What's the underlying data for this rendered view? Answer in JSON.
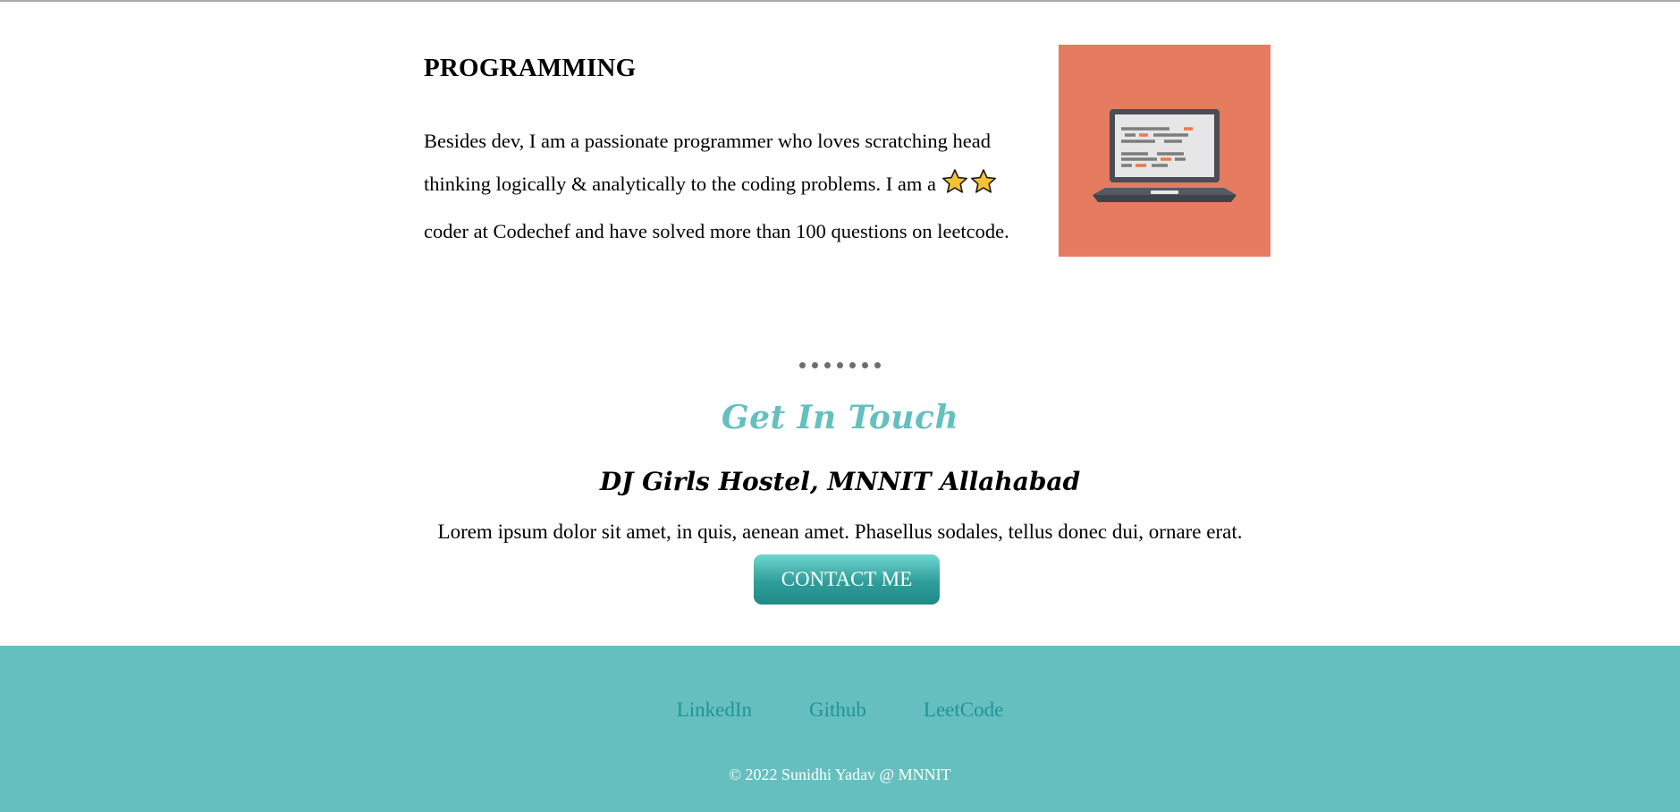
{
  "programming": {
    "title": "PROGRAMMING",
    "text_before_stars": "Besides dev, I am a passionate programmer who loves scratching head thinking logically & analytically to the coding problems. I am a",
    "star_rating": 2,
    "text_after_stars": "coder at Codechef and have solved more than 100 questions on leetcode.",
    "image_icon": "laptop-code-icon",
    "image_bg_color": "#e57b5f"
  },
  "separator": {
    "icon": "dots-separator"
  },
  "contact": {
    "title": "Get In Touch",
    "address": "DJ Girls Hostel, MNNIT Allahabad",
    "description": "Lorem ipsum dolor sit amet, in quis, aenean amet. Phasellus sodales, tellus donec dui, ornare erat.",
    "button_label": "CONTACT ME",
    "accent_color": "#66bfbf"
  },
  "footer": {
    "links": [
      "LinkedIn",
      "Github",
      "LeetCode"
    ],
    "copyright": "© 2022 Sunidhi Yadav @ MNNIT",
    "bg_color": "#66bfbf"
  }
}
